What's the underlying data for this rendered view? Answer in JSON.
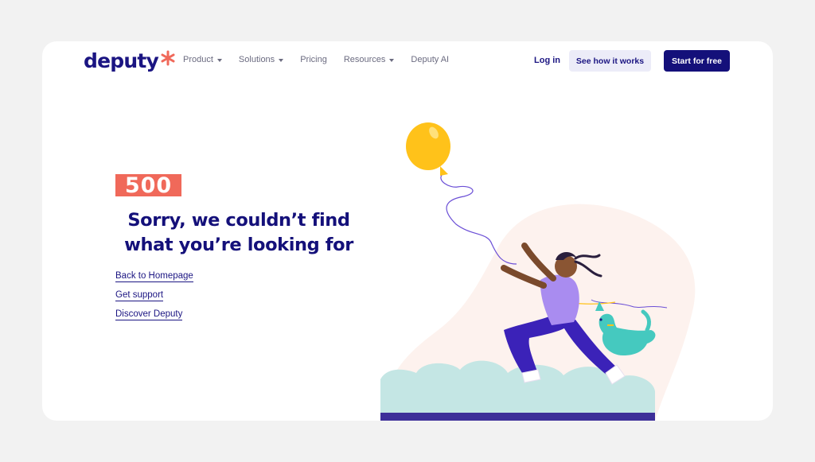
{
  "nav": {
    "logo_text": "deputy",
    "items": [
      {
        "label": "Product",
        "dropdown": true
      },
      {
        "label": "Solutions",
        "dropdown": true
      },
      {
        "label": "Pricing",
        "dropdown": false
      },
      {
        "label": "Resources",
        "dropdown": true
      },
      {
        "label": "Deputy AI",
        "dropdown": false
      }
    ],
    "login_label": "Log in",
    "how_label": "See how it works",
    "start_label": "Start for free"
  },
  "hero": {
    "code": "500",
    "headline_line1": "Sorry, we couldn’t find",
    "headline_line2": "what you’re looking for",
    "links": [
      "Back to Homepage",
      "Get support",
      "Discover Deputy"
    ]
  },
  "colors": {
    "brand": "#1b1582",
    "accent": "#f0695a",
    "balloon": "#ffc21a",
    "shirt": "#a98cf0",
    "pants": "#3b22b8",
    "dog": "#45c9bf",
    "blob": "#fdf2ee",
    "bushes": "#c4e6e4"
  }
}
